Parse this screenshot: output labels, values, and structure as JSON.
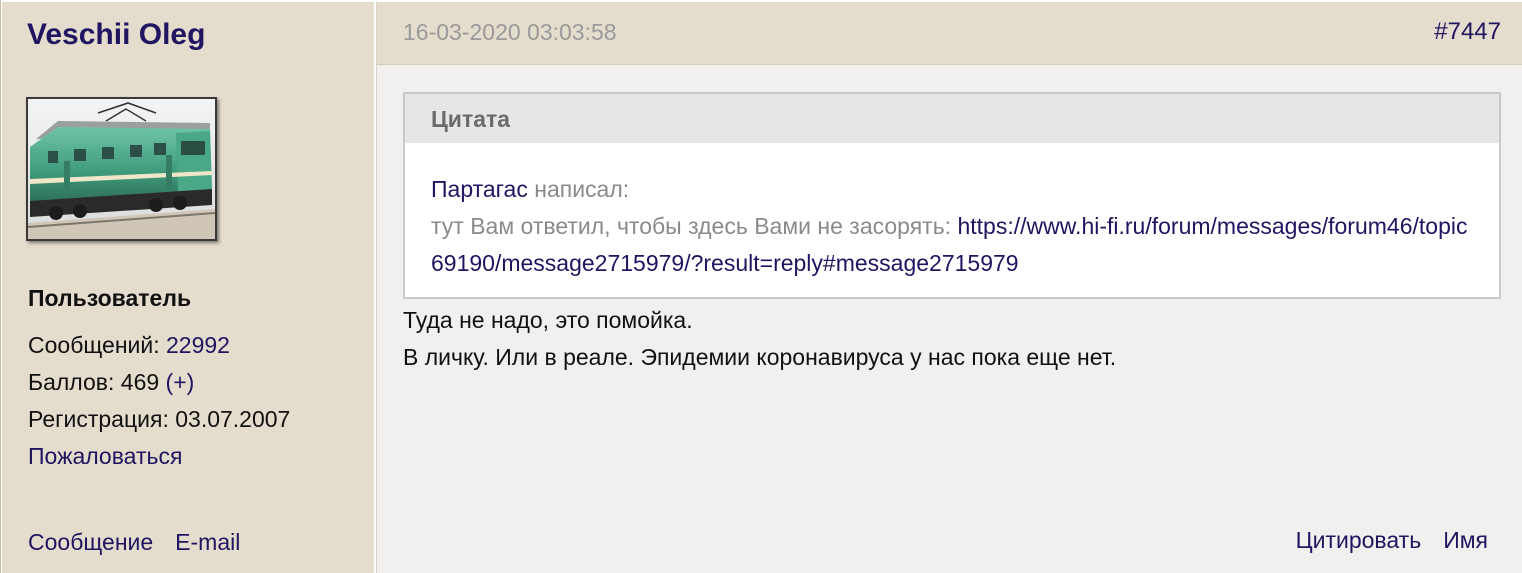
{
  "author": {
    "name": "Veschii Oleg",
    "avatar_icon": "electric-locomotive-avatar",
    "role": "Пользователь",
    "messages_label": "Сообщений: ",
    "messages_count": "22992",
    "score_label": "Баллов: 469 ",
    "score_plus": "(+)",
    "registration": "Регистрация: 03.07.2007",
    "report_label": "Пожаловаться",
    "message_label": "Сообщение",
    "email_label": "E-mail"
  },
  "post": {
    "date": "16-03-2020 03:03:58",
    "number": "#7447",
    "quote": {
      "title": "Цитата",
      "author": "Партагас",
      "wrote": " написал:",
      "text": "тут Вам ответил, чтобы здесь Вами не засорять: ",
      "url": "https://www.hi-fi.ru/forum/messages/forum46/topic69190/message2715979/?result=reply#message2715979"
    },
    "lines": [
      "Туда не надо, это помойка.",
      "В личку. Или в реале. Эпидемии коронавируса у нас пока еще нет."
    ],
    "quote_action": "Цитировать",
    "name_action": "Имя"
  },
  "colors": {
    "link": "#1f1560",
    "sidebar_bg": "#e4dccd",
    "content_bg": "#f1f0ee",
    "muted": "#9a9a9a"
  }
}
